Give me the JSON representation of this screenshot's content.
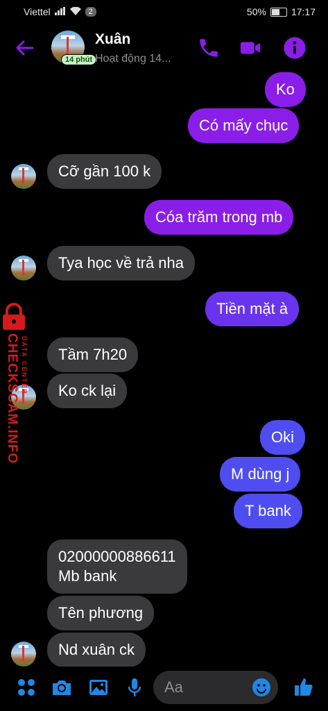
{
  "status": {
    "carrier": "Viettel",
    "notif_count": "2",
    "battery": "50%",
    "time": "17:17"
  },
  "header": {
    "name": "Xuân",
    "subtitle": "Hoạt động 14...",
    "active_badge": "14 phút"
  },
  "messages": [
    {
      "text": "Ko"
    },
    {
      "text": "Có mấy chục"
    },
    {
      "text": "Cỡ gần 100 k"
    },
    {
      "text": "Cóa trăm trong mb"
    },
    {
      "text": "Tya học về trả nha"
    },
    {
      "text": "Tiền mặt à"
    },
    {
      "text": "Tầm 7h20"
    },
    {
      "text": "Ko ck lại"
    },
    {
      "text": "Oki"
    },
    {
      "text": "M dùng j"
    },
    {
      "text": "T bank"
    },
    {
      "text": "02000000886611\nMb bank"
    },
    {
      "text": "Tên phương"
    },
    {
      "text": "Nd xuân ck"
    }
  ],
  "watermark": {
    "main": "CHECKSCAM.INFO",
    "sub": "DATA CENTER"
  },
  "composer": {
    "placeholder": "Aa"
  },
  "colors": {
    "accent": "#8a1ee8",
    "incoming": "#3a3a3c",
    "outgoing_blue": "#4f4df0",
    "icon": "#1e88e5"
  }
}
